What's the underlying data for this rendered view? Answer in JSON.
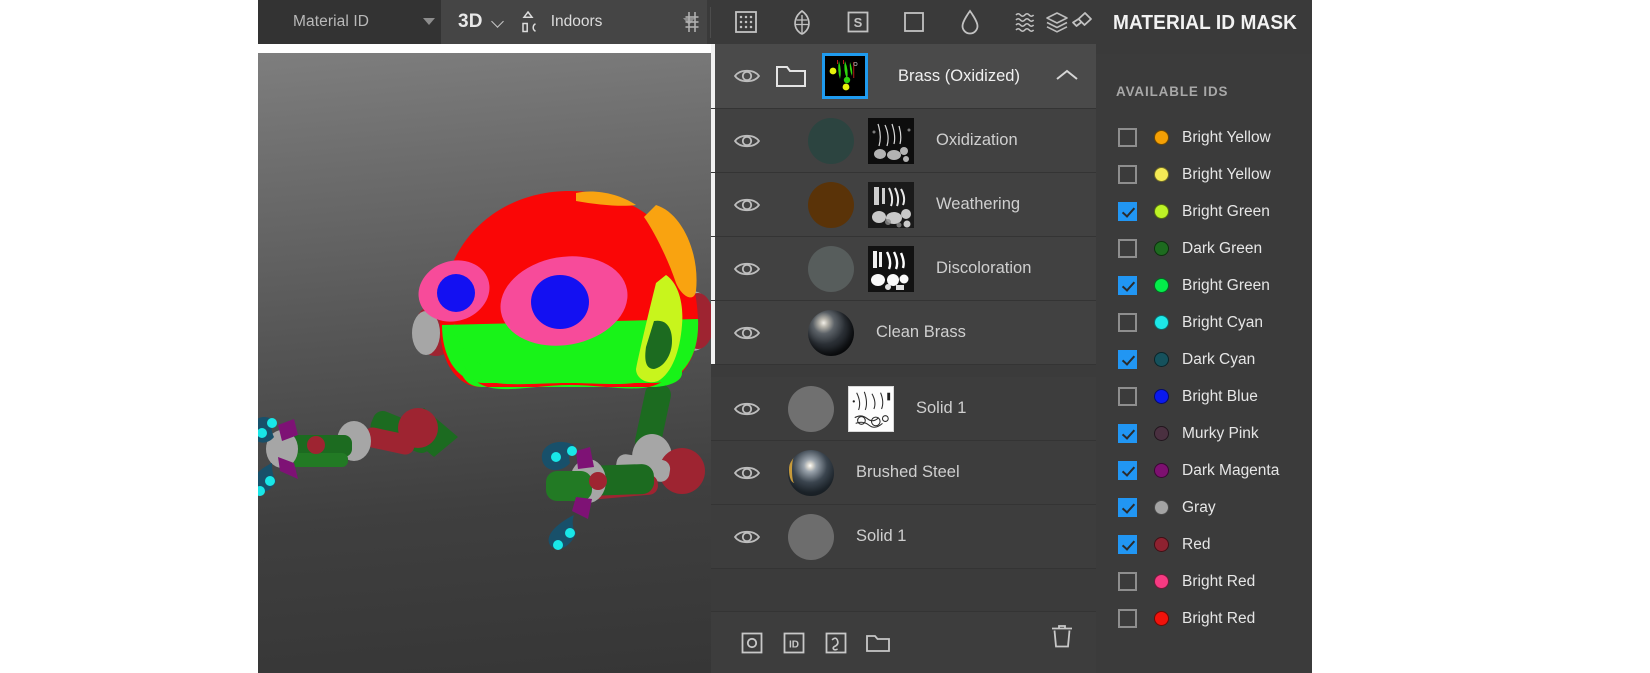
{
  "topbar": {
    "material_channel": "Material ID",
    "view_mode": "3D",
    "environment": "Indoors",
    "icons": [
      "grid-dots-icon",
      "leaf-icon",
      "smart-material-s-icon",
      "square-icon",
      "droplet-icon",
      "waves-icon",
      "brush-icon",
      "layers-stack-icon"
    ],
    "matid_caret": "chevron-down-icon",
    "env_caret": "chevron-down-icon",
    "grid_toggle": "grid-toggle-icon"
  },
  "panel": {
    "title": "MATERIAL ID MASK",
    "available_label": "AVAILABLE IDS"
  },
  "layers": {
    "bottom_icons": [
      "add-fill-layer-icon",
      "add-id-mask-icon",
      "add-curvature-icon",
      "add-folder-icon"
    ],
    "trash_icon": "trash-icon",
    "items": [
      {
        "name": "Brass (Oxidized)",
        "type": "group",
        "selected": true,
        "visible": true,
        "has_folder": true,
        "has_mask_thumb": true,
        "collapse": "chevron-up-icon"
      },
      {
        "name": "Oxidization",
        "type": "child",
        "selected": true,
        "visible": true,
        "swatch": "#2c4440",
        "has_mask_thumb": true
      },
      {
        "name": "Weathering",
        "type": "child",
        "selected": true,
        "visible": true,
        "swatch": "#5a3308",
        "has_mask_thumb": true
      },
      {
        "name": "Discoloration",
        "type": "child",
        "selected": true,
        "visible": true,
        "swatch": "#575d5c",
        "has_mask_thumb": true
      },
      {
        "name": "Clean Brass",
        "type": "child",
        "selected": true,
        "visible": true,
        "material_ball": "sphere"
      },
      {
        "name": "Solid 1",
        "type": "plain",
        "selected": false,
        "visible": true,
        "swatch": "#707070",
        "has_mask_thumb": true
      },
      {
        "name": "Brushed Steel",
        "type": "plain",
        "selected": false,
        "visible": true,
        "material_ball": "sphere2"
      },
      {
        "name": "Solid 1",
        "type": "plain",
        "selected": false,
        "visible": true,
        "swatch": "#6d6d6d"
      }
    ]
  },
  "available_ids": [
    {
      "label": "Bright Yellow",
      "color": "#f5a004",
      "checked": false
    },
    {
      "label": "Bright Yellow",
      "color": "#f5ea55",
      "checked": false
    },
    {
      "label": "Bright Green",
      "color": "#bdf326",
      "checked": true
    },
    {
      "label": "Dark Green",
      "color": "#1d6b1f",
      "checked": false
    },
    {
      "label": "Bright Green",
      "color": "#04ec4a",
      "checked": true
    },
    {
      "label": "Bright Cyan",
      "color": "#1de8e8",
      "checked": false
    },
    {
      "label": "Dark Cyan",
      "color": "#15515c",
      "checked": true
    },
    {
      "label": "Bright Blue",
      "color": "#0a19ee",
      "checked": false
    },
    {
      "label": "Murky Pink",
      "color": "#4a3040",
      "checked": true
    },
    {
      "label": "Dark Magenta",
      "color": "#7d1070",
      "checked": true
    },
    {
      "label": "Gray",
      "color": "#a4a4a4",
      "checked": true
    },
    {
      "label": "Red",
      "color": "#8e2230",
      "checked": true
    },
    {
      "label": "Bright Red",
      "color": "#f73a82",
      "checked": false
    },
    {
      "label": "Bright Red",
      "color": "#f1120b",
      "checked": false
    }
  ],
  "viewport": {
    "model": "robot-character-material-id-preview",
    "colors": {
      "head_red": "#fa0606",
      "body_green": "#18f318",
      "eye_pink": "#f74b9a",
      "eye_blue": "#1310f2",
      "orange": "#f9a310",
      "yellow_green": "#c8f51c",
      "dark_green": "#1c6b20",
      "mid_green": "#227a24",
      "gray": "#a6a6a6",
      "red_dark": "#9e2431",
      "teal": "#18506a",
      "cyan": "#19e7e8",
      "purple": "#7e1275"
    }
  }
}
